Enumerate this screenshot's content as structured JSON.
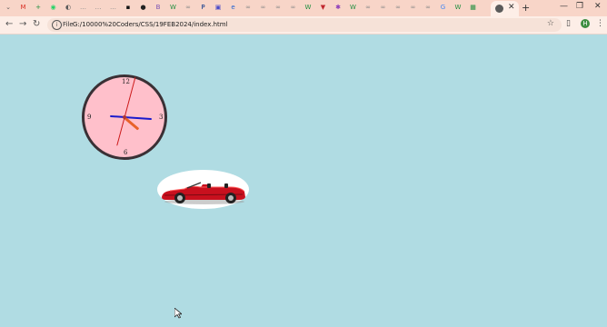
{
  "browser": {
    "address_chip": "File",
    "url": "G:/10000%20Coders/CSS/19FEB2024/index.html",
    "profile_initial": "H",
    "active_tab_close": "✕",
    "new_tab": "+",
    "window_controls": {
      "minimize": "—",
      "restore": "❐",
      "close": "✕"
    },
    "pinned_tabs": [
      {
        "icon": "chevron-down-icon",
        "label": "⌄",
        "color": "#5a5a5a"
      },
      {
        "icon": "gmail-icon",
        "label": "M",
        "color": "#d93025"
      },
      {
        "icon": "plus-app-icon",
        "label": "+",
        "color": "#1e8e3e"
      },
      {
        "icon": "whatsapp-icon",
        "label": "◉",
        "color": "#25d366"
      },
      {
        "icon": "globe-icon",
        "label": "◐",
        "color": "#5a5a5a"
      },
      {
        "icon": "ellipsis-icon",
        "label": "…",
        "color": "#888"
      },
      {
        "icon": "ellipsis-icon",
        "label": "…",
        "color": "#888"
      },
      {
        "icon": "ellipsis-icon",
        "label": "…",
        "color": "#888"
      },
      {
        "icon": "tab-icon",
        "label": "▪",
        "color": "#111"
      },
      {
        "icon": "github-icon",
        "label": "●",
        "color": "#222"
      },
      {
        "icon": "bootstrap-icon",
        "label": "B",
        "color": "#7952b3"
      },
      {
        "icon": "w-icon",
        "label": "W",
        "color": "#1e8e3e"
      },
      {
        "icon": "link-icon",
        "label": "∞",
        "color": "#888"
      },
      {
        "icon": "paypal-icon",
        "label": "P",
        "color": "#003087"
      },
      {
        "icon": "site-icon",
        "label": "▣",
        "color": "#4b4bc8"
      },
      {
        "icon": "e-icon",
        "label": "e",
        "color": "#2060d0"
      },
      {
        "icon": "link-icon",
        "label": "∞",
        "color": "#888"
      },
      {
        "icon": "link-icon",
        "label": "∞",
        "color": "#888"
      },
      {
        "icon": "link-icon",
        "label": "∞",
        "color": "#888"
      },
      {
        "icon": "link-icon",
        "label": "∞",
        "color": "#888"
      },
      {
        "icon": "w-icon",
        "label": "W",
        "color": "#1e8e3e"
      },
      {
        "icon": "vercel-icon",
        "label": "▼",
        "color": "#c0262d"
      },
      {
        "icon": "puzzle-icon",
        "label": "✱",
        "color": "#8a3ab9"
      },
      {
        "icon": "w-icon",
        "label": "W",
        "color": "#1e8e3e"
      },
      {
        "icon": "link-icon",
        "label": "∞",
        "color": "#888"
      },
      {
        "icon": "link-icon",
        "label": "∞",
        "color": "#888"
      },
      {
        "icon": "link-icon",
        "label": "∞",
        "color": "#888"
      },
      {
        "icon": "link-icon",
        "label": "∞",
        "color": "#888"
      },
      {
        "icon": "link-icon",
        "label": "∞",
        "color": "#888"
      },
      {
        "icon": "google-icon",
        "label": "G",
        "color": "#4285f4"
      },
      {
        "icon": "w-icon",
        "label": "W",
        "color": "#1e8e3e"
      },
      {
        "icon": "sheets-icon",
        "label": "▦",
        "color": "#1e8e3e"
      }
    ]
  },
  "clock": {
    "numerals": {
      "top": "12",
      "right": "3",
      "bottom": "6",
      "left": "9"
    },
    "face_color": "#ffc0cb",
    "border_color": "#3a3035",
    "hour_hand_color": "#e8622a",
    "minute_hand_color": "#1a1acc",
    "second_hand_color": "#cc1a1a"
  },
  "car": {
    "body_color": "#c8101e",
    "oval_color": "#ffffff"
  },
  "page": {
    "background": "#b0dce3"
  }
}
